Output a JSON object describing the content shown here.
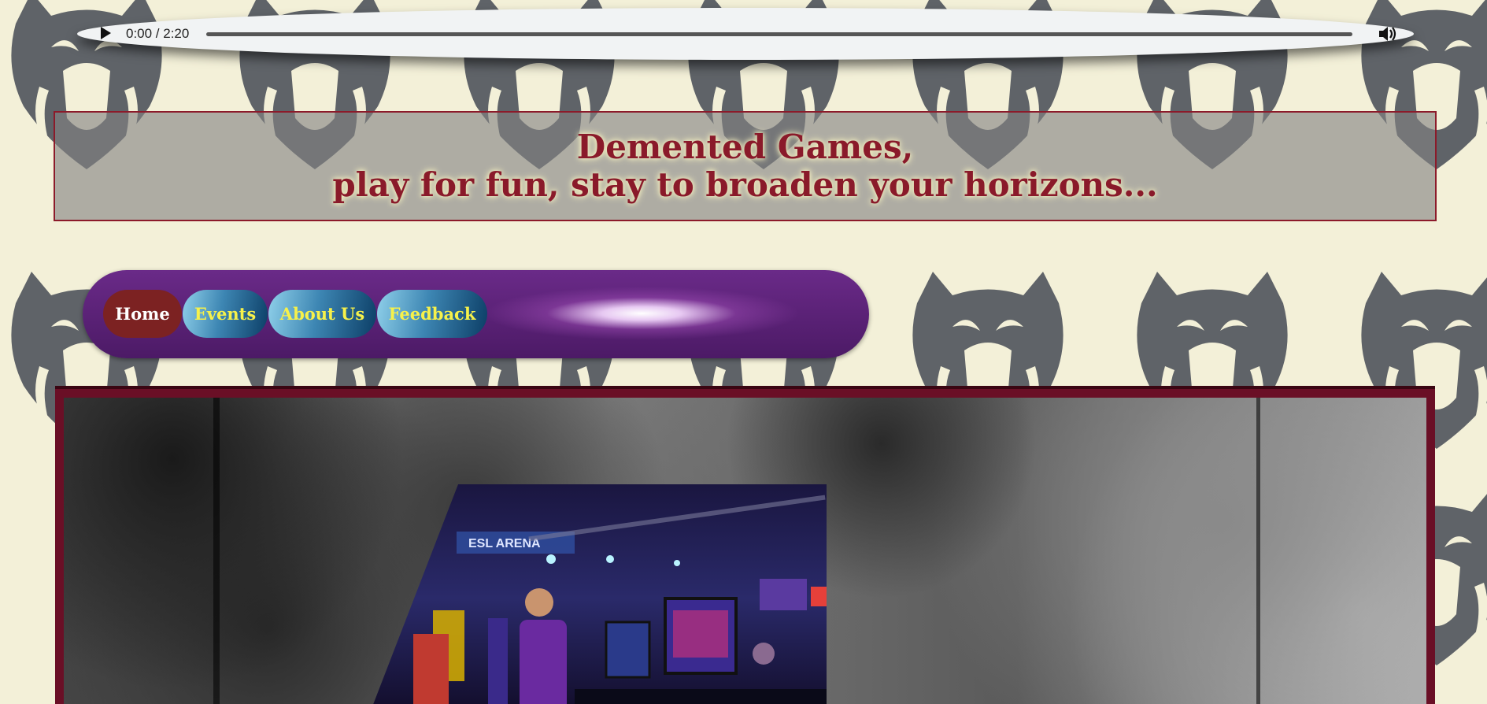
{
  "audio": {
    "time": "0:00 / 2:20",
    "progress": 0,
    "play_icon": "play-icon",
    "volume_icon": "volume-icon"
  },
  "header": {
    "line1": "Demented Games,",
    "line2": "play for fun, stay to broaden your horizons..."
  },
  "nav": {
    "items": [
      {
        "label": "Home",
        "active": true
      },
      {
        "label": "Events",
        "active": false
      },
      {
        "label": "About Us",
        "active": false
      },
      {
        "label": "Feedback",
        "active": false
      }
    ]
  },
  "colors": {
    "background": "#f3f0d8",
    "pattern": "#5f6368",
    "title": "#8a1a2a",
    "nav_text": "#f6f14a",
    "frame": "#6a0f26"
  }
}
